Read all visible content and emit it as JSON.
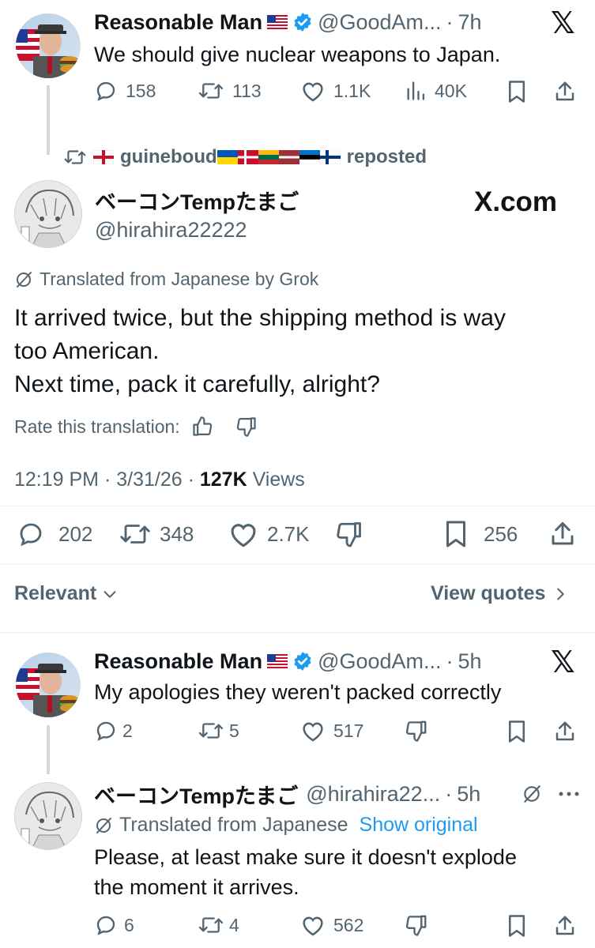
{
  "post1": {
    "name": "Reasonable Man",
    "handle": "@GoodAm...",
    "time": "7h",
    "text": "We should give nuclear weapons to Japan.",
    "replies": "158",
    "reposts": "113",
    "likes": "1.1K",
    "views": "40K"
  },
  "repost_banner": {
    "user": "guineboud",
    "suffix": "reposted"
  },
  "main": {
    "name": "ベーコンTempたまご",
    "handle": "@hirahira22222",
    "site_logo": "X.com",
    "translated_note": "Translated from Japanese by Grok",
    "text_line1": "It arrived twice, but the shipping method is way",
    "text_line2": "too American.",
    "text_line3": "Next time, pack it carefully, alright?",
    "rate_label": "Rate this translation:",
    "timestamp": "12:19 PM · 3/31/26 · ",
    "views_count": "127K",
    "views_label": " Views",
    "replies": "202",
    "reposts": "348",
    "likes": "2.7K",
    "bookmarks": "256"
  },
  "sort": {
    "relevant": "Relevant",
    "view_quotes": "View quotes"
  },
  "reply1": {
    "name": "Reasonable Man",
    "handle": "@GoodAm...",
    "time": "5h",
    "text": "My apologies they weren't packed correctly",
    "replies": "2",
    "reposts": "5",
    "likes": "517"
  },
  "reply2": {
    "name": "ベーコンTempたまご",
    "handle": "@hirahira22...",
    "time": "5h",
    "translated_note": "Translated from Japanese",
    "show_original": "Show original",
    "text_line1": "Please, at least make sure it doesn't explode",
    "text_line2": "the moment it arrives.",
    "replies": "6",
    "reposts": "4",
    "likes": "562"
  },
  "colors": {
    "text": "#0f1419",
    "secondary": "#536471",
    "link": "#1d9bf0",
    "verified": "#1d9bf0"
  }
}
